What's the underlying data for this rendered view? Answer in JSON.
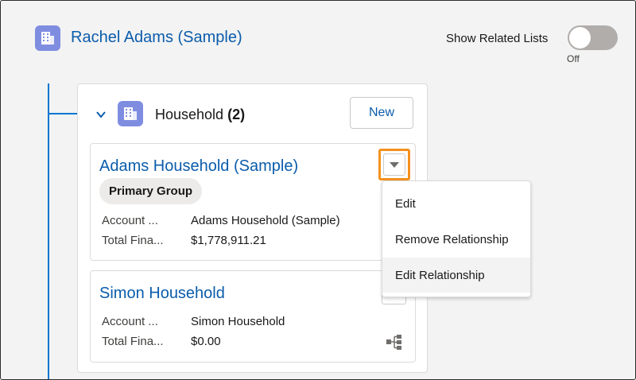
{
  "record": {
    "title": "Rachel Adams (Sample)",
    "icon": "building-icon"
  },
  "toggle": {
    "label": "Show Related Lists",
    "state": "Off",
    "on": false
  },
  "household": {
    "title": "Household",
    "count": "(2)",
    "new_label": "New",
    "icon": "building-icon"
  },
  "cards": [
    {
      "title": "Adams Household (Sample)",
      "badge": "Primary Group",
      "fields": [
        {
          "label": "Account ...",
          "value": "Adams Household (Sample)"
        },
        {
          "label": "Total Fina...",
          "value": "$1,778,911.21"
        }
      ]
    },
    {
      "title": "Simon Household",
      "fields": [
        {
          "label": "Account ...",
          "value": "Simon Household"
        },
        {
          "label": "Total Fina...",
          "value": "$0.00"
        }
      ]
    }
  ],
  "menu": {
    "items": [
      "Edit",
      "Remove Relationship",
      "Edit Relationship"
    ],
    "active_index": 2
  },
  "colors": {
    "link": "#0b5cab",
    "icon_bg": "#7f8de1",
    "highlight": "#f4911f",
    "tree_line": "#0176d3"
  }
}
